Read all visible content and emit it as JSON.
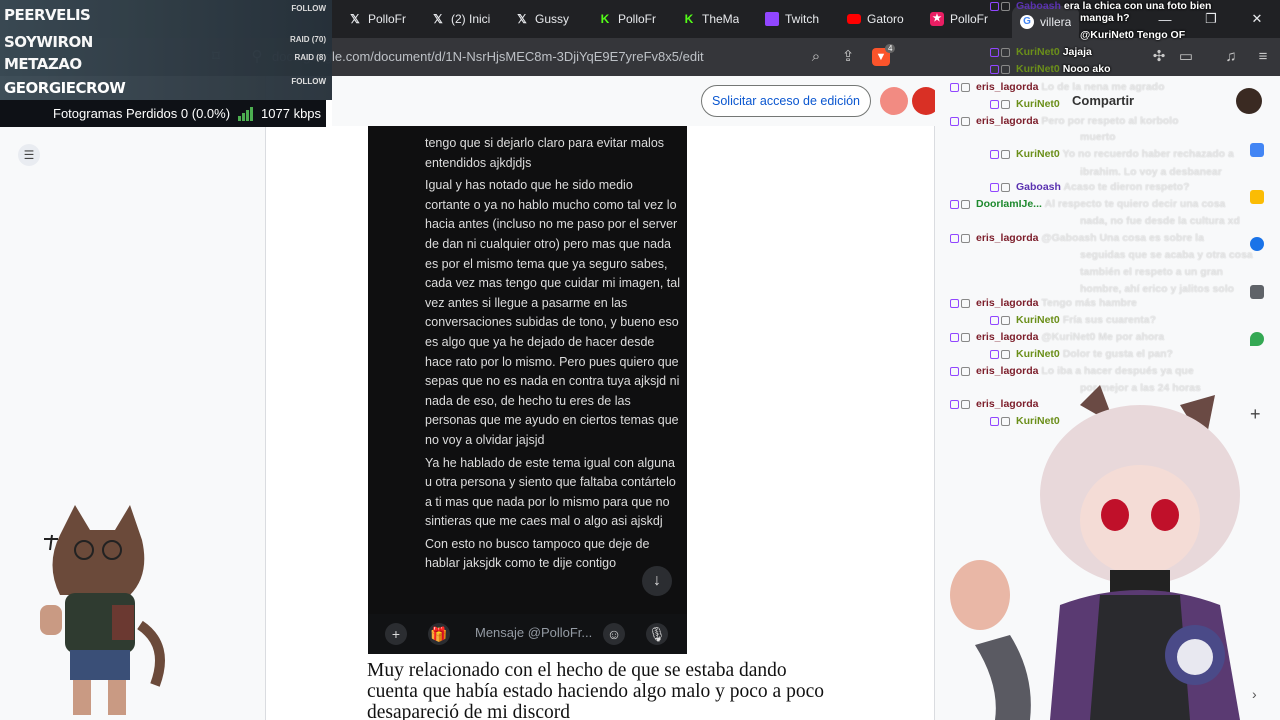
{
  "browser": {
    "tabs": [
      {
        "label": "PolloFr",
        "icon": "x-icon"
      },
      {
        "label": "(2) Inici",
        "icon": "x-icon"
      },
      {
        "label": "Gussy",
        "icon": "x-icon"
      },
      {
        "label": "PolloFr",
        "icon": "kick-icon"
      },
      {
        "label": "TheMa",
        "icon": "kick-icon"
      },
      {
        "label": "Twitch",
        "icon": "twitch-icon"
      },
      {
        "label": "Gatoro",
        "icon": "youtube-icon"
      },
      {
        "label": "PolloFr",
        "icon": "pink-star-icon"
      },
      {
        "label": "villera",
        "icon": "google-icon"
      }
    ],
    "url": "docs.google.com/document/d/1N-NsrHjsMEC8m-3DjiYqE9E7yreFv8x5/edit",
    "shield_badge": "4"
  },
  "obs": {
    "raiders": [
      {
        "name": "PEERVELIS",
        "tag": "FOLLOW"
      },
      {
        "name": "SOYWIRON",
        "tag": "RAID (70)"
      },
      {
        "name": "METAZAO",
        "tag": "RAID (8)"
      },
      {
        "name": "GEORGIECROW",
        "tag": "FOLLOW"
      }
    ],
    "dropped_frames": "Fotogramas Perdidos 0 (0.0%)",
    "bitrate": "1077 kbps"
  },
  "docs": {
    "request_edit_label": "Solicitar acceso de edición",
    "share_label": "Compartir",
    "phone_message": [
      "tengo que si dejarlo claro para evitar malos entendidos ajkdjdjs",
      "Igual y has notado que he sido medio cortante o ya no hablo mucho como tal vez lo hacia antes (incluso no me paso por el server de dan ni cualquier otro) pero mas que nada es por el mismo tema que ya seguro sabes, cada vez mas tengo que cuidar mi imagen, tal vez antes si llegue a pasarme en las conversaciones subidas de tono, y bueno eso es algo que ya he dejado de hacer desde hace rato por lo mismo. Pero pues quiero que sepas que no es nada en contra tuya ajksjd ni nada de eso, de hecho tu eres de las personas que me ayudo en ciertos temas que no voy a olvidar jajsjd",
      "Ya he hablado de este tema igual con alguna u otra persona y siento que faltaba contártelo a ti mas que nada por lo mismo para que no sintieras que me caes mal o algo asi ajskdj",
      "Con esto no busco tampoco que deje de hablar jaksjdk como te dije contigo"
    ],
    "composer_placeholder": "Mensaje @PolloFr...",
    "paragraph": "Muy relacionado con el hecho de que se estaba dando cuenta que había estado haciendo algo malo y poco a poco desapareció de mi discord"
  },
  "chat": {
    "lines": [
      {
        "user": "Gaboash",
        "msg": "era la chica con una foto bien",
        "style": "p"
      },
      {
        "user": "",
        "msg": "manga h?",
        "style": ""
      },
      {
        "user": "",
        "msg": "@KuriNet0 Tengo OF",
        "style": ""
      },
      {
        "user": "KuriNet0",
        "msg": "Jajaja",
        "style": "g"
      },
      {
        "user": "KuriNet0",
        "msg": "Nooo ako",
        "style": "g"
      },
      {
        "user": "eris_lagorda",
        "msg": "Lo de la nena me agrado",
        "style": ""
      },
      {
        "user": "KuriNet0",
        "msg": "",
        "style": "g"
      },
      {
        "user": "eris_lagorda",
        "msg": "Pero por respeto al korbolo",
        "style": ""
      },
      {
        "user": "",
        "msg": "muerto",
        "style": ""
      },
      {
        "user": "KuriNet0",
        "msg": "Yo no recuerdo haber rechazado a",
        "style": "g"
      },
      {
        "user": "",
        "msg": "ibrahim. Lo voy a desbanear",
        "style": ""
      },
      {
        "user": "Gaboash",
        "msg": "Acaso te dieron respeto?",
        "style": "p"
      },
      {
        "user": "DoorIamIJe...",
        "msg": "Al respecto te quiero decir una cosa",
        "style": "gr"
      },
      {
        "user": "",
        "msg": "nada, no fue desde la cultura xd",
        "style": ""
      },
      {
        "user": "eris_lagorda",
        "msg": "@Gaboash Una cosa es sobre la",
        "style": ""
      },
      {
        "user": "",
        "msg": "seguidas que se acaba y otra cosa",
        "style": ""
      },
      {
        "user": "",
        "msg": "también el respeto a un gran",
        "style": ""
      },
      {
        "user": "",
        "msg": "hombre, ahí erico y jalitos solo",
        "style": ""
      },
      {
        "user": "eris_lagorda",
        "msg": "Tengo más hambre",
        "style": ""
      },
      {
        "user": "KuriNet0",
        "msg": "Fría sus cuarenta?",
        "style": "g"
      },
      {
        "user": "eris_lagorda",
        "msg": "@KuriNet0 Me por ahora",
        "style": ""
      },
      {
        "user": "KuriNet0",
        "msg": "Dolor te gusta el pan?",
        "style": "g"
      },
      {
        "user": "eris_lagorda",
        "msg": "Lo iba a hacer después ya que",
        "style": ""
      },
      {
        "user": "",
        "msg": "por mejor a las 24 horas",
        "style": ""
      },
      {
        "user": "eris_lagorda",
        "msg": "",
        "style": ""
      },
      {
        "user": "KuriNet0",
        "msg": "",
        "style": "g"
      }
    ]
  }
}
